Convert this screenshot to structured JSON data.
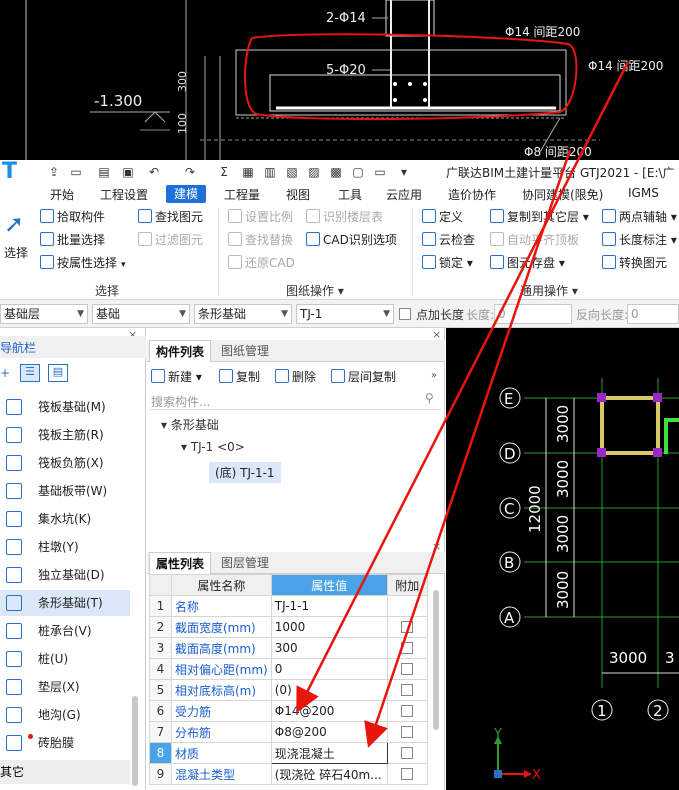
{
  "cad_top": {
    "labels": {
      "bar_top": "2-Φ14",
      "bar_main": "5-Φ20",
      "note_right": "Φ14 间距200",
      "note_mid": "Φ14 间距200",
      "note_bottom": "Φ8 间距200",
      "elevation": "-1.300",
      "dim_300": "300",
      "dim_100": "100"
    }
  },
  "titlebar": {
    "title": "广联达BIM土建计量平台 GTJ2021 - [E:\\广"
  },
  "menu": {
    "items": [
      "开始",
      "工程设置",
      "建模",
      "工程量",
      "视图",
      "工具",
      "云应用",
      "造价协作",
      "协同建模(限免)",
      "IGMS"
    ],
    "active": "建模"
  },
  "ribbon": {
    "select_label": "选择",
    "select_group": [
      "拾取构件",
      "批量选择",
      "按属性选择"
    ],
    "find_group": [
      "查找图元",
      "过滤图元"
    ],
    "drawing_group": [
      "设置比例",
      "识别楼层表",
      "查找替换",
      "CAD识别选项",
      "还原CAD"
    ],
    "general_group": [
      "定义",
      "复制到其它层",
      "两点辅轴",
      "云检查",
      "自动平齐顶板",
      "长度标注",
      "锁定",
      "图元存盘",
      "转换图元"
    ],
    "group_labels": {
      "select": "选择",
      "drawing": "图纸操作",
      "general": "通用操作"
    }
  },
  "selectors": {
    "floor": "基础层",
    "type": "基础",
    "subtype": "条形基础",
    "component": "TJ-1",
    "point_length_label": "点加长度",
    "length_label": "长度:",
    "length_value": "0",
    "reverse_length_label": "反向长度:",
    "reverse_length_value": "0"
  },
  "nav": {
    "title": "导航栏",
    "items": [
      {
        "label": "筏板基础(M)",
        "icon": "raft-icon"
      },
      {
        "label": "筏板主筋(R)",
        "icon": "raft-main-bar-icon"
      },
      {
        "label": "筏板负筋(X)",
        "icon": "raft-neg-bar-icon"
      },
      {
        "label": "基础板带(W)",
        "icon": "strip-icon"
      },
      {
        "label": "集水坑(K)",
        "icon": "sump-icon"
      },
      {
        "label": "柱墩(Y)",
        "icon": "pier-icon"
      },
      {
        "label": "独立基础(D)",
        "icon": "isolated-footing-icon"
      },
      {
        "label": "条形基础(T)",
        "icon": "strip-footing-icon"
      },
      {
        "label": "桩承台(V)",
        "icon": "pile-cap-icon"
      },
      {
        "label": "桩(U)",
        "icon": "pile-icon"
      },
      {
        "label": "垫层(X)",
        "icon": "cushion-icon"
      },
      {
        "label": "地沟(G)",
        "icon": "trench-icon"
      },
      {
        "label": "砖胎膜",
        "icon": "brick-mold-icon"
      }
    ],
    "selected": "条形基础(T)",
    "footer": "其它"
  },
  "component_list": {
    "tabs": [
      "构件列表",
      "图纸管理"
    ],
    "toolbar": [
      "新建",
      "复制",
      "删除",
      "层间复制"
    ],
    "search_placeholder": "搜索构件...",
    "tree": {
      "root": "条形基础",
      "child": "TJ-1 <0>",
      "leaf": "(底) TJ-1-1"
    }
  },
  "property_list": {
    "tabs": [
      "属性列表",
      "图层管理"
    ],
    "headers": [
      "属性名称",
      "属性值",
      "附加"
    ],
    "rows": [
      {
        "n": "1",
        "name": "名称",
        "value": "TJ-1-1",
        "check": false
      },
      {
        "n": "2",
        "name": "截面宽度(mm)",
        "value": "1000",
        "check": true
      },
      {
        "n": "3",
        "name": "截面高度(mm)",
        "value": "300",
        "check": true
      },
      {
        "n": "4",
        "name": "相对偏心距(mm)",
        "value": "0",
        "check": true
      },
      {
        "n": "5",
        "name": "相对底标高(m)",
        "value": "(0)",
        "check": true
      },
      {
        "n": "6",
        "name": "受力筋",
        "value": "Φ14@200",
        "check": true
      },
      {
        "n": "7",
        "name": "分布筋",
        "value": "Φ8@200",
        "check": true
      },
      {
        "n": "8",
        "name": "材质",
        "value": "现浇混凝土",
        "check": true
      },
      {
        "n": "9",
        "name": "混凝土类型",
        "value": "(现浇砼 碎石40m...",
        "check": true
      }
    ],
    "highlight_row": "8"
  },
  "cad_bottom": {
    "axes_rows": [
      "E",
      "D",
      "C",
      "B",
      "A"
    ],
    "axes_cols": [
      "1",
      "2"
    ],
    "dims_vertical": [
      "3000",
      "3000",
      "3000",
      "3000"
    ],
    "dim_total": "12000",
    "dim_horizontal": "3000",
    "dim_horizontal_2": "3",
    "ucs_x": "X",
    "ucs_y": "Y"
  },
  "colors": {
    "accent": "#1e6fd9",
    "prop_name": "#1a5fd0",
    "header_blue": "#4aa3e8",
    "annotation": "#e8140e",
    "cad_bg": "#000000"
  }
}
